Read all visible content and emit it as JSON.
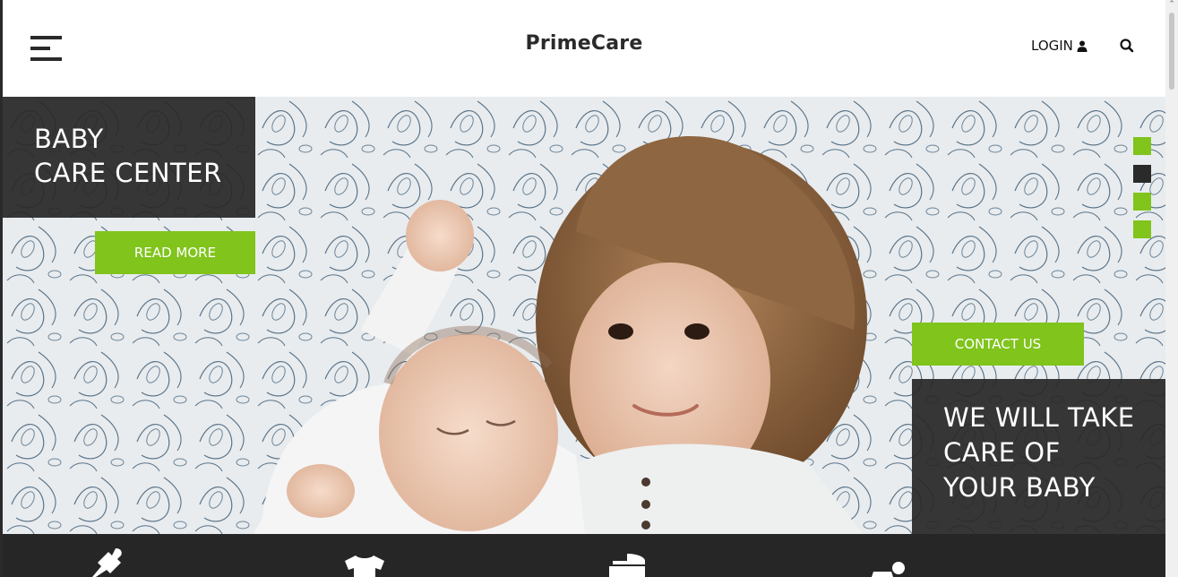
{
  "header": {
    "brand": "PrimeCare",
    "login_label": "LOGIN",
    "icons": {
      "menu": "hamburger-menu-icon",
      "user": "user-icon",
      "search": "search-icon"
    }
  },
  "hero": {
    "panel_left": {
      "line1": "BABY",
      "line2": "CARE CENTER"
    },
    "read_more_label": "READ MORE",
    "contact_label": "CONTACT US",
    "panel_right": {
      "line1": "WE WILL TAKE",
      "line2": "CARE OF",
      "line3": "YOUR BABY"
    },
    "slider": {
      "count": 4,
      "active_index": 1
    }
  },
  "feature_icons": [
    "baby-bottle-icon",
    "baby-onesie-icon",
    "baby-stroller-icon",
    "crawling-baby-icon"
  ],
  "colors": {
    "accent": "#80c41c",
    "dark": "#2a2a2a",
    "panel": "#282828"
  }
}
